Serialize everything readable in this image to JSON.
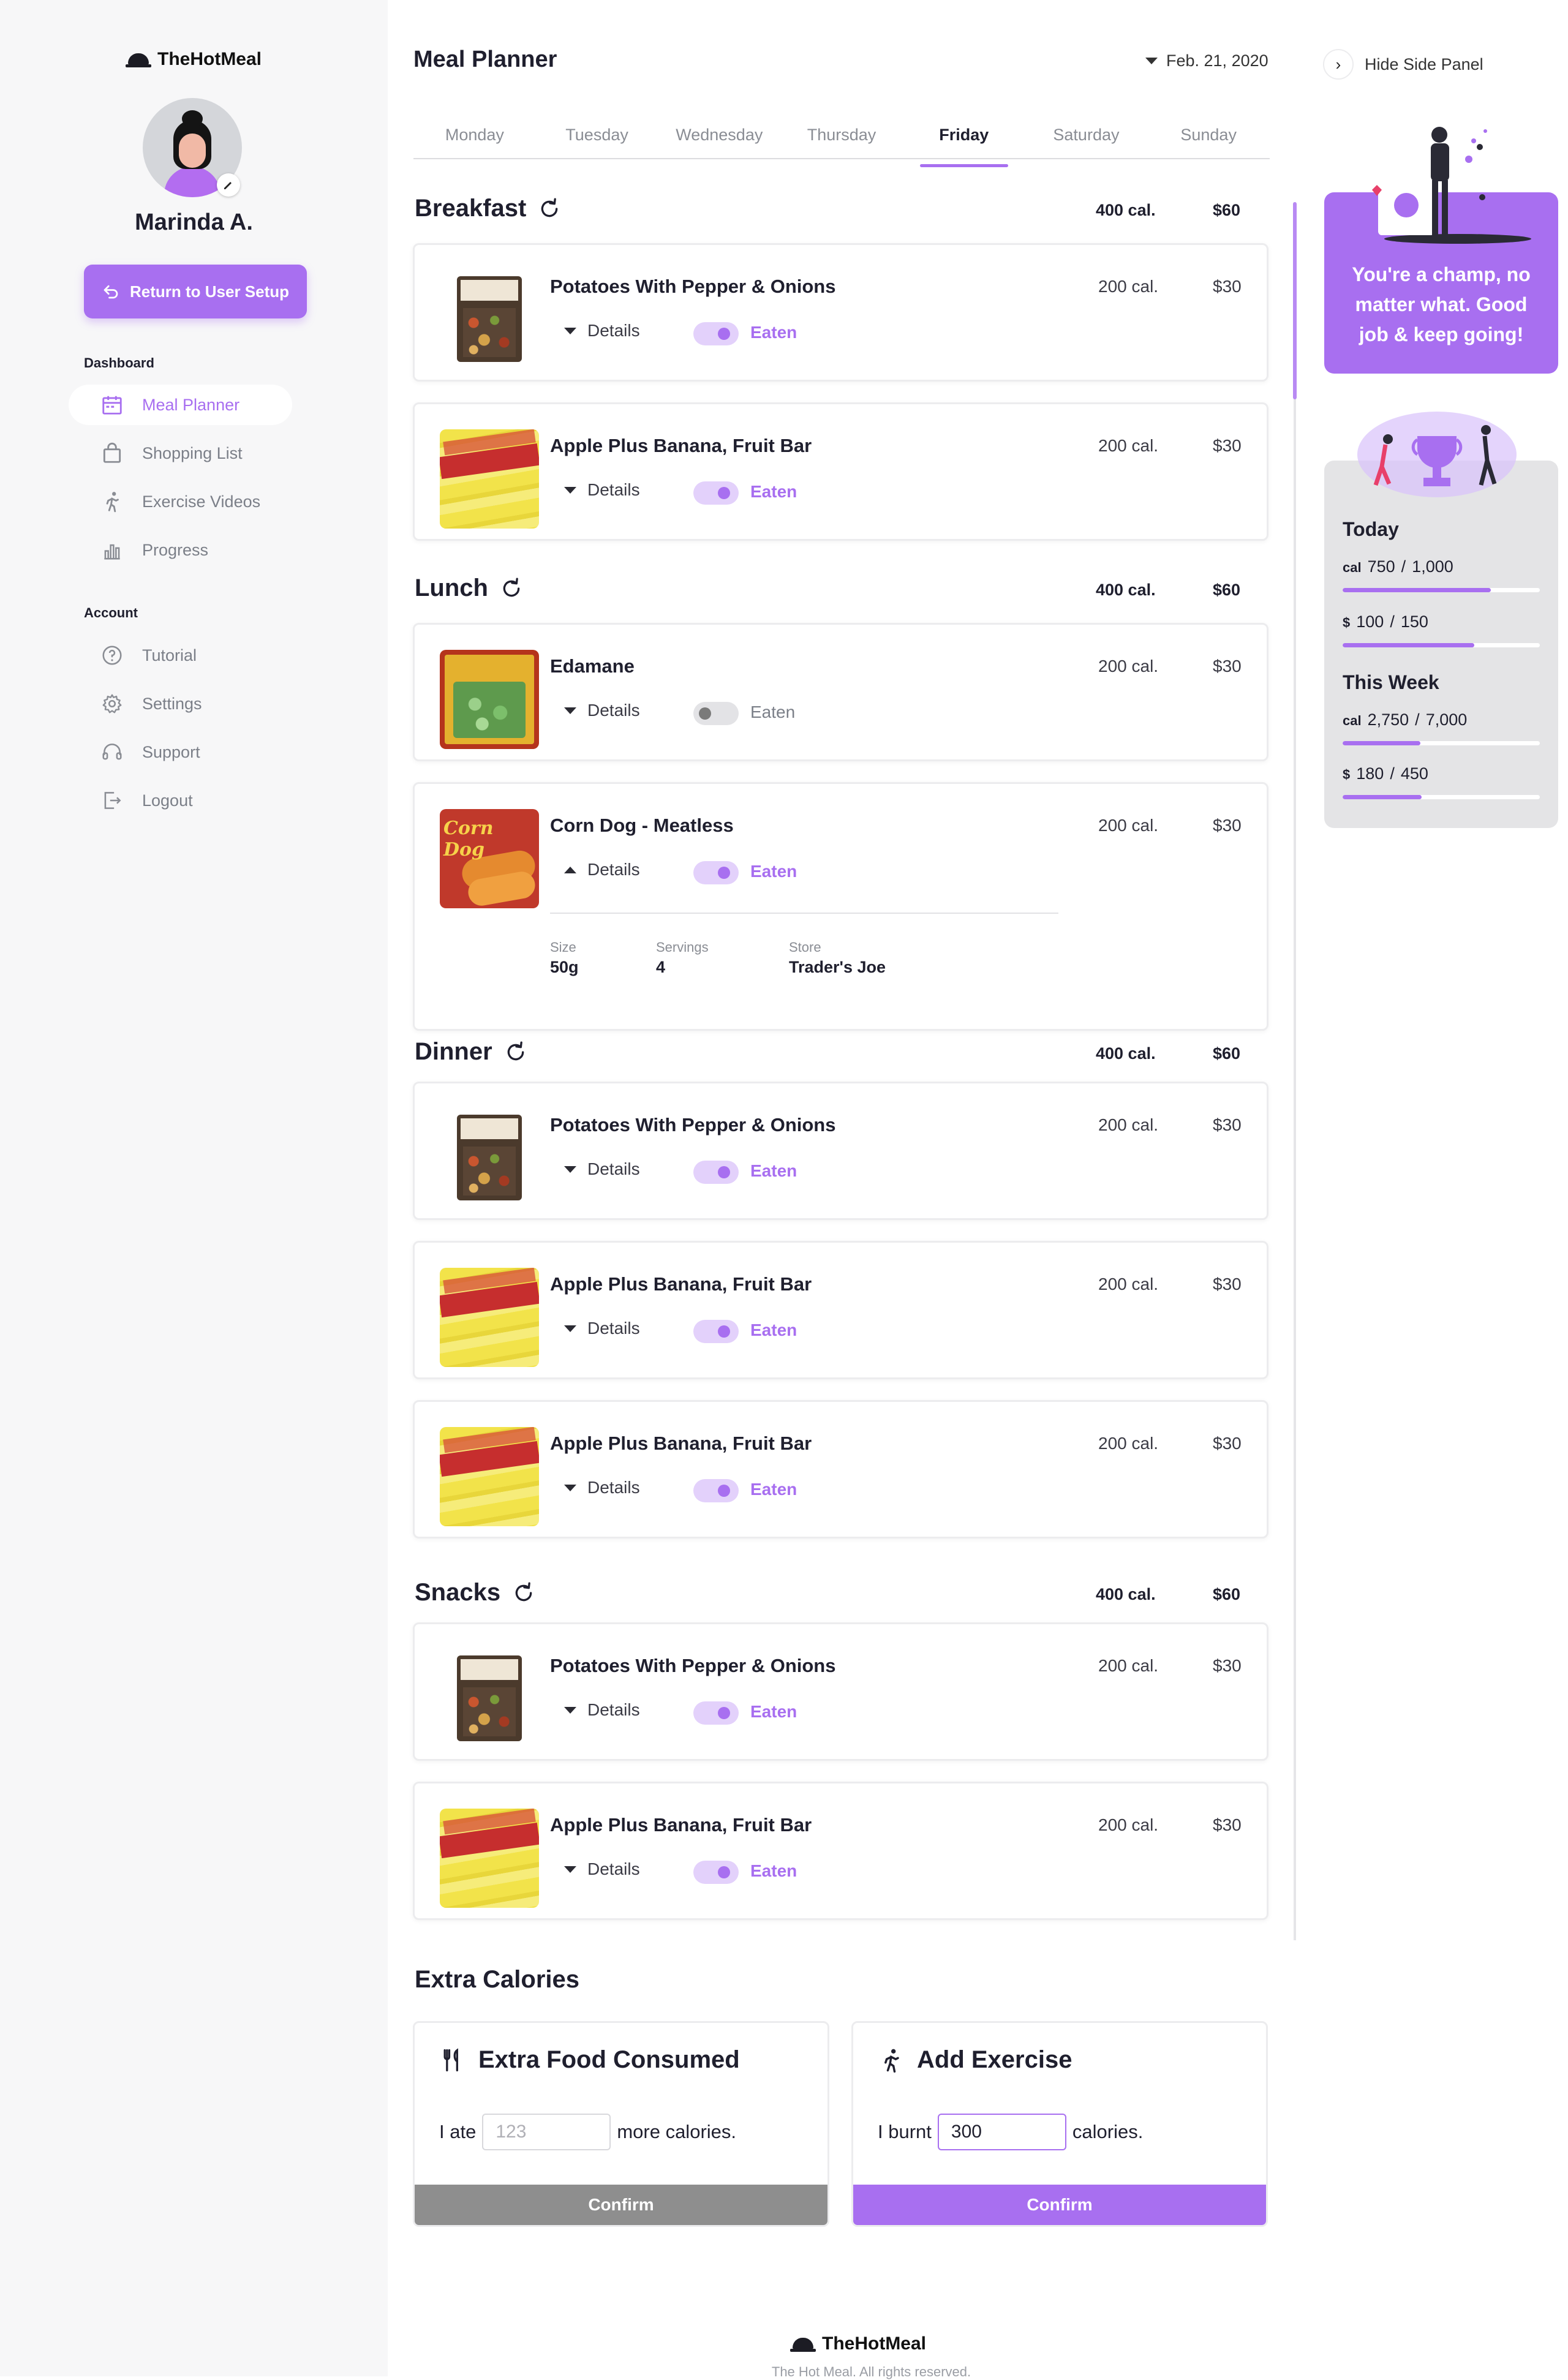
{
  "brand": {
    "name": "TheHotMeal"
  },
  "sidebar": {
    "user_name": "Marinda A.",
    "return_button": "Return to User Setup",
    "dashboard_heading": "Dashboard",
    "dashboard_items": [
      {
        "label": "Meal Planner",
        "icon": "calendar-icon",
        "active": true
      },
      {
        "label": "Shopping List",
        "icon": "shopping-bag-icon"
      },
      {
        "label": "Exercise Videos",
        "icon": "runner-icon"
      },
      {
        "label": "Progress",
        "icon": "bar-chart-icon"
      }
    ],
    "account_heading": "Account",
    "account_items": [
      {
        "label": "Tutorial",
        "icon": "help-circle-icon"
      },
      {
        "label": "Settings",
        "icon": "gear-icon"
      },
      {
        "label": "Support",
        "icon": "headset-icon"
      },
      {
        "label": "Logout",
        "icon": "logout-icon"
      }
    ]
  },
  "header": {
    "title": "Meal Planner",
    "date": "Feb. 21, 2020"
  },
  "tabs": [
    "Monday",
    "Tuesday",
    "Wednesday",
    "Thursday",
    "Friday",
    "Saturday",
    "Sunday"
  ],
  "active_tab": "Friday",
  "labels": {
    "details": "Details",
    "eaten": "Eaten",
    "size": "Size",
    "servings": "Servings",
    "store": "Store"
  },
  "sections": [
    {
      "name": "Breakfast",
      "cal": "400 cal.",
      "price": "$60",
      "items": [
        {
          "name": "Potatoes With Pepper & Onions",
          "cal": "200 cal.",
          "price": "$30",
          "eaten": true,
          "image": "potato"
        },
        {
          "name": "Apple Plus Banana, Fruit Bar",
          "cal": "200 cal.",
          "price": "$30",
          "eaten": true,
          "image": "fruitbar"
        }
      ]
    },
    {
      "name": "Lunch",
      "cal": "400 cal.",
      "price": "$60",
      "items": [
        {
          "name": "Edamane",
          "cal": "200 cal.",
          "price": "$30",
          "eaten": false,
          "image": "edamame"
        },
        {
          "name": "Corn Dog - Meatless",
          "cal": "200 cal.",
          "price": "$30",
          "eaten": true,
          "image": "corndog",
          "expanded": true,
          "size": "50g",
          "servings": "4",
          "store": "Trader's Joe"
        }
      ]
    },
    {
      "name": "Dinner",
      "cal": "400 cal.",
      "price": "$60",
      "items": [
        {
          "name": "Potatoes With Pepper & Onions",
          "cal": "200 cal.",
          "price": "$30",
          "eaten": true,
          "image": "potato"
        },
        {
          "name": "Apple Plus Banana, Fruit Bar",
          "cal": "200 cal.",
          "price": "$30",
          "eaten": true,
          "image": "fruitbar"
        },
        {
          "name": "Apple Plus Banana, Fruit Bar",
          "cal": "200 cal.",
          "price": "$30",
          "eaten": true,
          "image": "fruitbar"
        }
      ]
    },
    {
      "name": "Snacks",
      "cal": "400 cal.",
      "price": "$60",
      "items": [
        {
          "name": "Potatoes With Pepper & Onions",
          "cal": "200 cal.",
          "price": "$30",
          "eaten": true,
          "image": "potato"
        },
        {
          "name": "Apple Plus Banana, Fruit Bar",
          "cal": "200 cal.",
          "price": "$30",
          "eaten": true,
          "image": "fruitbar"
        }
      ]
    }
  ],
  "extra": {
    "title": "Extra Calories",
    "food": {
      "title": "Extra Food Consumed",
      "prefix": "I ate",
      "placeholder": "123",
      "suffix": "more calories.",
      "button": "Confirm"
    },
    "exercise": {
      "title": "Add Exercise",
      "prefix": "I burnt",
      "value": "300",
      "suffix": "calories.",
      "button": "Confirm"
    }
  },
  "footer": {
    "brand": "TheHotMeal",
    "copyright": "The Hot Meal. All rights reserved."
  },
  "side_panel": {
    "hide_label": "Hide Side Panel",
    "champ_text": "You're a champ, no matter what. Good job & keep going!",
    "today": {
      "title": "Today",
      "cal": {
        "unit": "cal",
        "current": "750",
        "total": "1,000",
        "fraction": 0.75
      },
      "money": {
        "unit": "$",
        "current": "100",
        "total": "150",
        "fraction": 0.667
      }
    },
    "week": {
      "title": "This Week",
      "cal": {
        "unit": "cal",
        "current": "2,750",
        "total": "7,000",
        "fraction": 0.393
      },
      "money": {
        "unit": "$",
        "current": "180",
        "total": "450",
        "fraction": 0.4
      }
    }
  },
  "colors": {
    "accent": "#a86ff0",
    "disabled": "#8e8e8e"
  }
}
